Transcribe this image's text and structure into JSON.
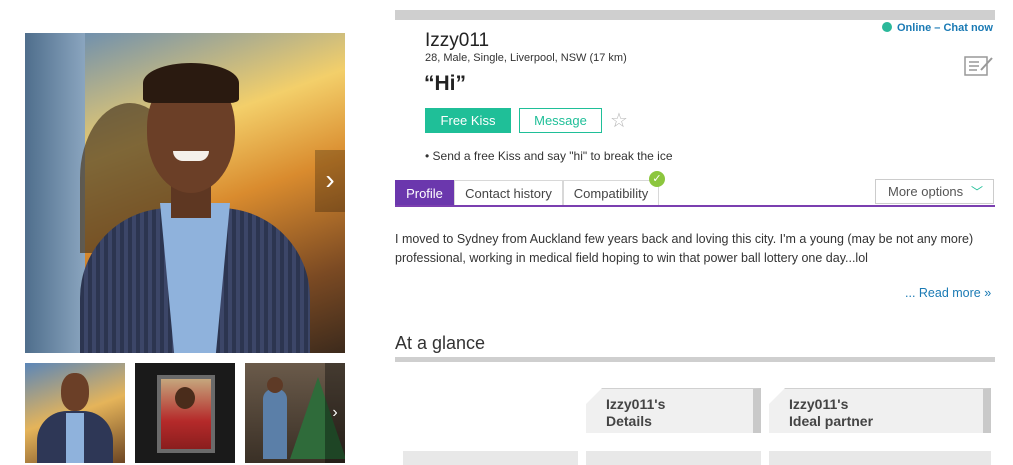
{
  "status": {
    "online_text": "Online – Chat now",
    "dot_color": "#2bb89a"
  },
  "profile": {
    "username": "Izzy011",
    "info": "28, Male, Single, Liverpool, NSW (17 km)",
    "headline": "“Hi”"
  },
  "actions": {
    "kiss_label": "Free Kiss",
    "message_label": "Message",
    "kiss_tip": "• Send a free Kiss and say \"hi\" to break the ice"
  },
  "tabs": [
    {
      "label": "Profile",
      "active": true
    },
    {
      "label": "Contact history"
    },
    {
      "label": "Compatibility"
    }
  ],
  "more_options": "More options",
  "about": {
    "text": "I moved to Sydney from Auckland few years back and loving this city. I'm a young (may be not any more) professional, working in medical field hoping to win that power ball lottery one day...lol",
    "read_more": "... Read more »"
  },
  "glance": {
    "title": "At a glance",
    "cards": [
      {
        "owner": "Izzy011's",
        "label": "Details"
      },
      {
        "owner": "Izzy011's",
        "label": "Ideal partner"
      }
    ]
  },
  "colors": {
    "accent": "#1fbf98",
    "tab_active": "#6b37ad",
    "link": "#1a7ab4"
  }
}
